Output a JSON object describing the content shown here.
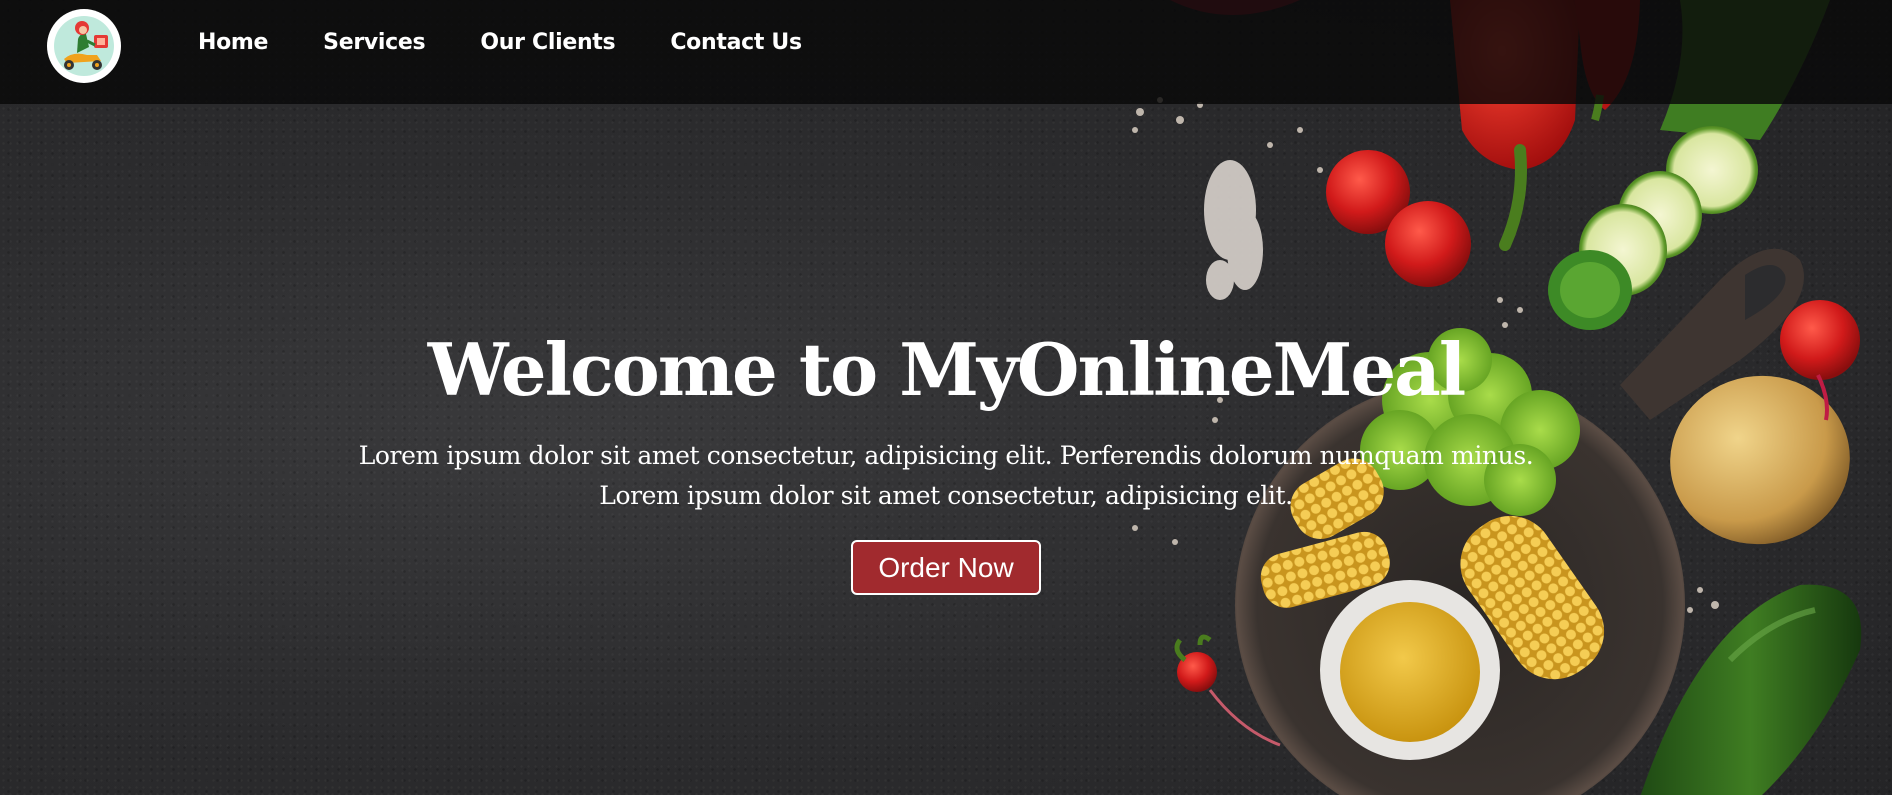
{
  "brand": {
    "logo_icon": "delivery-scooter-icon"
  },
  "nav": {
    "items": [
      {
        "label": "Home"
      },
      {
        "label": "Services"
      },
      {
        "label": "Our Clients"
      },
      {
        "label": "Contact Us"
      }
    ]
  },
  "hero": {
    "title": "Welcome to MyOnlineMeal",
    "subtitle_line1": "Lorem ipsum dolor sit amet consectetur, adipisicing elit. Perferendis dolorum numquam minus.",
    "subtitle_line2": "Lorem ipsum dolor sit amet consectetur, adipisicing elit.",
    "cta_label": "Order Now",
    "background_image": "vegetables-on-dark-slate"
  },
  "colors": {
    "navbar_bg": "#0a0a0a",
    "hero_bg": "#2c2c2e",
    "button_bg": "#a12a2e",
    "text": "#ffffff"
  }
}
